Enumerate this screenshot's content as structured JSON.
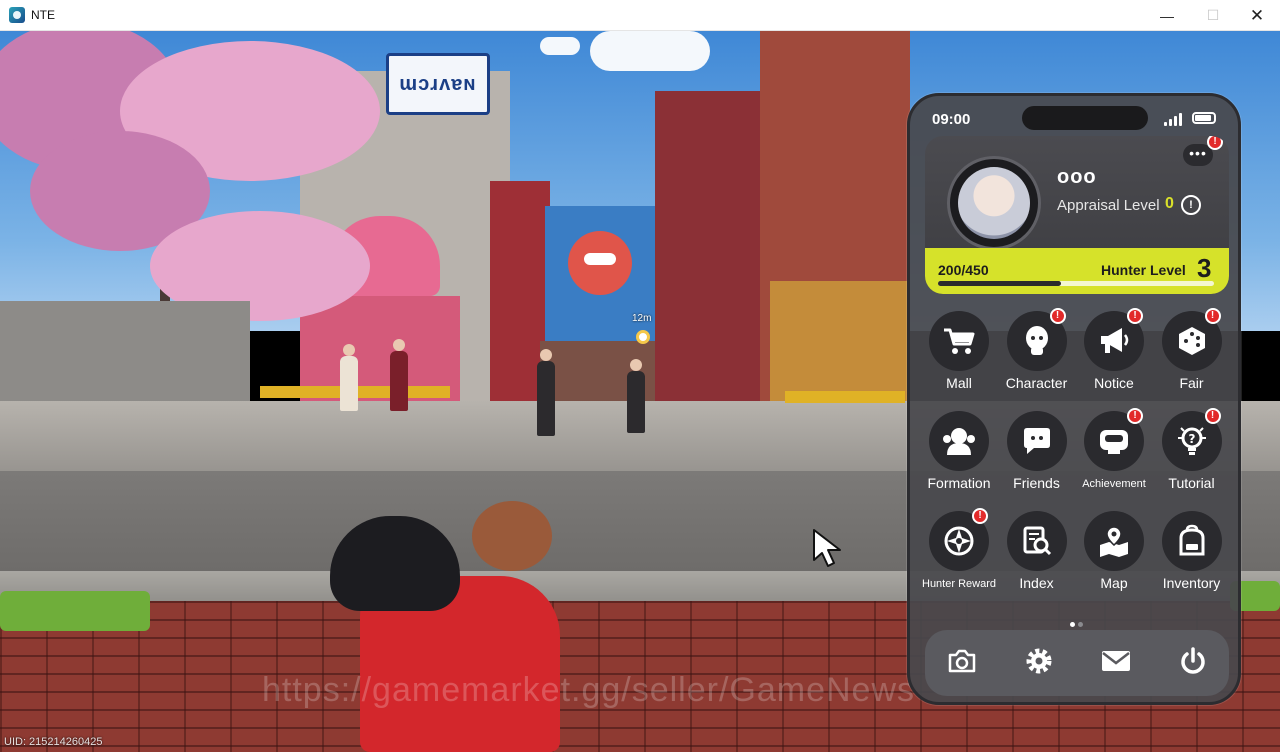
{
  "window": {
    "title": "NTE",
    "minimize_glyph": "—",
    "maximize_glyph": "☐",
    "close_glyph": "✕"
  },
  "game": {
    "watermark": "https://gamemarket.gg/seller/GameNews",
    "uid": "UID: 215214260425",
    "waypoint_distance": "12m",
    "shop_sign": "ɯɔɹʌɐɴ"
  },
  "phone": {
    "time": "09:00",
    "more_label": "•••",
    "profile": {
      "name": "ooo",
      "appraisal_label": "Appraisal Level",
      "appraisal_value": "0",
      "info_glyph": "!",
      "xp_text": "200/450",
      "xp_fraction": 0.444,
      "hunter_label": "Hunter Level",
      "hunter_value": "3"
    },
    "menu": [
      {
        "label": "Mall",
        "icon": "cart-icon",
        "badge": false
      },
      {
        "label": "Character",
        "icon": "character-icon",
        "badge": true
      },
      {
        "label": "Notice",
        "icon": "megaphone-icon",
        "badge": true
      },
      {
        "label": "Fair",
        "icon": "dice-icon",
        "badge": true
      },
      {
        "label": "Formation",
        "icon": "formation-icon",
        "badge": false
      },
      {
        "label": "Friends",
        "icon": "chat-bubble-icon",
        "badge": false
      },
      {
        "label": "Achievement",
        "icon": "achievement-icon",
        "badge": true
      },
      {
        "label": "Tutorial",
        "icon": "lightbulb-icon",
        "badge": true
      },
      {
        "label": "Hunter Reward",
        "icon": "compass-icon",
        "badge": true
      },
      {
        "label": "Index",
        "icon": "index-search-icon",
        "badge": false
      },
      {
        "label": "Map",
        "icon": "map-pin-icon",
        "badge": false
      },
      {
        "label": "Inventory",
        "icon": "backpack-icon",
        "badge": false
      }
    ],
    "badge_glyph": "!",
    "page_count": 2,
    "page_active": 1,
    "dock": [
      {
        "icon": "camera-icon"
      },
      {
        "icon": "settings-icon"
      },
      {
        "icon": "mail-icon"
      },
      {
        "icon": "power-icon"
      }
    ]
  },
  "colors": {
    "accent": "#d6e22a",
    "badge": "#e22a2a",
    "panel": "#48484c"
  }
}
